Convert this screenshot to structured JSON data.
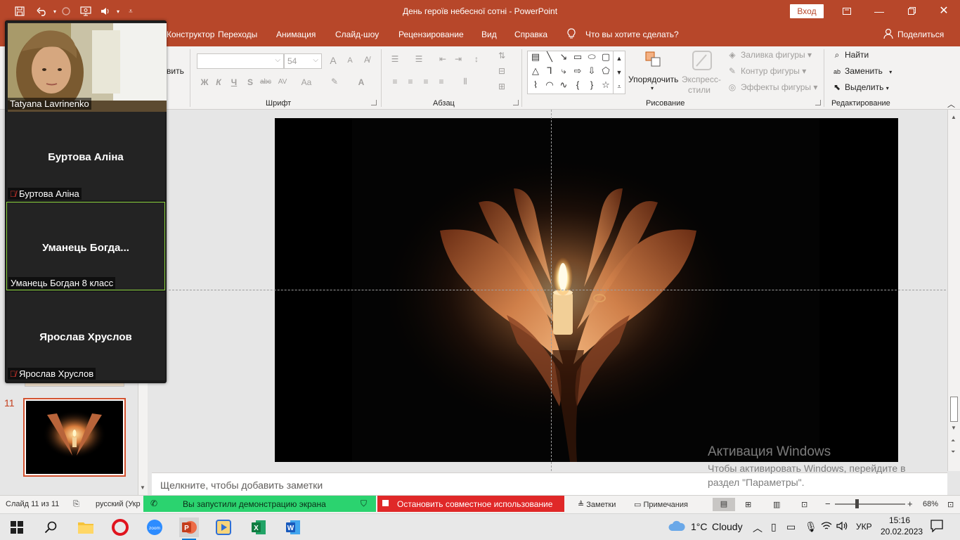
{
  "titlebar": {
    "doc_title": "День героїв небесної сотні  -  PowerPoint",
    "sign_in": "Вход",
    "qa_icons": [
      "save-icon",
      "undo-icon",
      "redo-icon",
      "present-icon",
      "speaker-icon",
      "customize-icon"
    ]
  },
  "tabs": {
    "items": [
      "Конструктор",
      "Переходы",
      "Анимация",
      "Слайд-шоу",
      "Рецензирование",
      "Вид",
      "Справка"
    ],
    "tell_me": "Что вы хотите сделать?",
    "share": "Поделиться"
  },
  "ribbon": {
    "font_group": "Шрифт",
    "paragraph_group": "Абзац",
    "drawing_group": "Рисование",
    "editing_group": "Редактирование",
    "clipboard_partial": "вить",
    "font_size_placeholder": "54",
    "arrange": "Упорядочить",
    "quick_styles_1": "Экспресс-",
    "quick_styles_2": "стили",
    "shape_fill": "Заливка фигуры",
    "shape_outline": "Контур фигуры",
    "shape_effects": "Эффекты фигуры",
    "find": "Найти",
    "replace": "Заменить",
    "select": "Выделить",
    "bold": "Ж",
    "italic": "К",
    "underline": "Ч",
    "strike": "S",
    "strike_abc": "abc",
    "spacing": "AV",
    "case": "Aa",
    "color_a": "A",
    "font_grow": "A",
    "font_shrink": "A"
  },
  "thumbnails": {
    "current_number": "11"
  },
  "notes": {
    "placeholder": "Щелкните, чтобы добавить заметки"
  },
  "activation": {
    "title": "Активация Windows",
    "subtitle": "Чтобы активировать Windows, перейдите в раздел \"Параметры\"."
  },
  "statusbar": {
    "slide_info": "Слайд 11 из 11",
    "language": "русский (Укр",
    "sharing_notice": "Вы запустили демонстрацию экрана",
    "stop_sharing": "Остановить совместное использование",
    "notes_btn": "Заметки",
    "comments_btn": "Примечания",
    "zoom_level": "68%",
    "zoom_minus": "−",
    "zoom_plus": "+"
  },
  "zoom_panel": {
    "participants": [
      {
        "name": "Tatyana Lavrinenko",
        "video": true,
        "muted": false
      },
      {
        "name": "Буртова Аліна",
        "display": "Буртова Аліна",
        "video": false,
        "muted": true
      },
      {
        "name": "Уманець Богдан 8 класс",
        "display": "Уманець  Богда...",
        "video": false,
        "muted": false,
        "speaking": true
      },
      {
        "name": "Ярослав Хруслов",
        "display": "Ярослав Хруслов",
        "video": false,
        "muted": true
      }
    ]
  },
  "taskbar": {
    "apps": [
      "windows-start",
      "search",
      "file-explorer",
      "opera",
      "zoom",
      "powerpoint",
      "media-player",
      "excel",
      "word"
    ],
    "weather_temp": "1°C",
    "weather_text": "Cloudy",
    "language": "УКР",
    "time": "15:16",
    "date": "20.02.2023"
  },
  "colors": {
    "accent": "#b7472a",
    "share_green": "#2bd36f",
    "share_red": "#e02828",
    "speaking_border": "#8bd33d"
  }
}
